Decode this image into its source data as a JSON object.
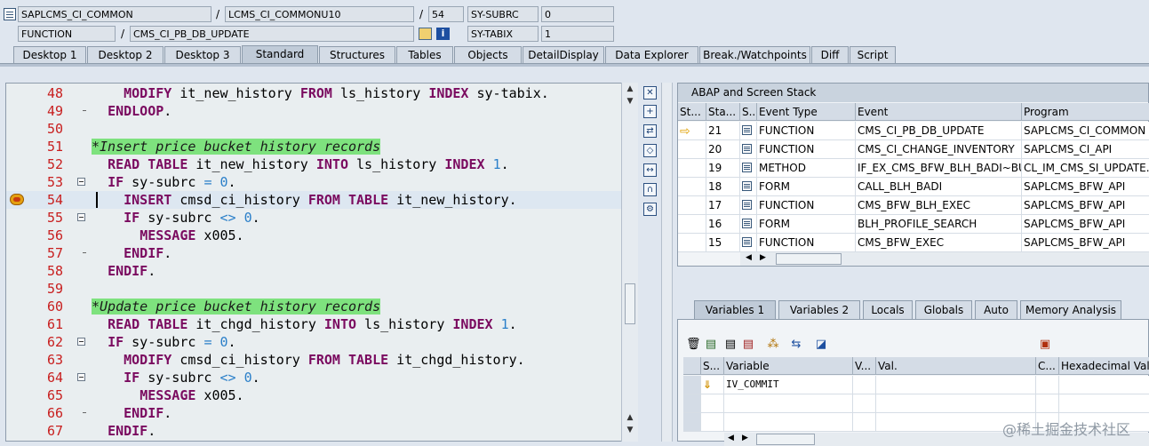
{
  "header": {
    "row1": {
      "program": "SAPLCMS_CI_COMMON",
      "include": "LCMS_CI_COMMONU10",
      "line": "54",
      "field_name": "SY-SUBRC",
      "field_value": "0"
    },
    "row2": {
      "type": "FUNCTION",
      "name": "CMS_CI_PB_DB_UPDATE",
      "field_name": "SY-TABIX",
      "field_value": "1"
    },
    "separator": "/",
    "info_glyph": "i"
  },
  "tabs": [
    "Desktop 1",
    "Desktop 2",
    "Desktop 3",
    "Standard",
    "Structures",
    "Tables",
    "Objects",
    "DetailDisplay",
    "Data Explorer",
    "Break./Watchpoints",
    "Diff",
    "Script"
  ],
  "active_tab": "Standard",
  "editor": {
    "lines": [
      {
        "n": "48",
        "tokens": [
          [
            "    ",
            ""
          ],
          [
            "MODIFY",
            "kw"
          ],
          [
            " it_new_history ",
            ""
          ],
          [
            "FROM",
            "kw"
          ],
          [
            " ls_history ",
            ""
          ],
          [
            "INDEX",
            "kw"
          ],
          [
            " sy-tabix.",
            ""
          ]
        ]
      },
      {
        "n": "49",
        "tokens": [
          [
            "  ",
            ""
          ],
          [
            "ENDLOOP",
            "kw"
          ],
          [
            ".",
            ""
          ]
        ]
      },
      {
        "n": "50",
        "tokens": []
      },
      {
        "n": "51",
        "tokens": [
          [
            "*Insert price bucket history records",
            "cmt"
          ]
        ]
      },
      {
        "n": "52",
        "tokens": [
          [
            "  ",
            ""
          ],
          [
            "READ TABLE",
            "kw"
          ],
          [
            " it_new_history ",
            ""
          ],
          [
            "INTO",
            "kw"
          ],
          [
            " ls_history ",
            ""
          ],
          [
            "INDEX",
            "kw"
          ],
          [
            " ",
            ""
          ],
          [
            "1",
            "num"
          ],
          [
            ".",
            ""
          ]
        ]
      },
      {
        "n": "53",
        "tokens": [
          [
            "  ",
            ""
          ],
          [
            "IF",
            "kw"
          ],
          [
            " sy-subrc ",
            ""
          ],
          [
            "=",
            "num"
          ],
          [
            " ",
            ""
          ],
          [
            "0",
            "num"
          ],
          [
            ".",
            ""
          ]
        ]
      },
      {
        "n": "54",
        "tokens": [
          [
            "    ",
            ""
          ],
          [
            "INSERT",
            "kw"
          ],
          [
            " cmsd_ci_history ",
            ""
          ],
          [
            "FROM TABLE",
            "kw"
          ],
          [
            " it_new_history.",
            ""
          ]
        ]
      },
      {
        "n": "55",
        "tokens": [
          [
            "    ",
            ""
          ],
          [
            "IF",
            "kw"
          ],
          [
            " sy-subrc ",
            ""
          ],
          [
            "<>",
            "num"
          ],
          [
            " ",
            ""
          ],
          [
            "0",
            "num"
          ],
          [
            ".",
            ""
          ]
        ]
      },
      {
        "n": "56",
        "tokens": [
          [
            "      ",
            ""
          ],
          [
            "MESSAGE",
            "kw"
          ],
          [
            " x005.",
            ""
          ]
        ]
      },
      {
        "n": "57",
        "tokens": [
          [
            "    ",
            ""
          ],
          [
            "ENDIF",
            "kw"
          ],
          [
            ".",
            ""
          ]
        ]
      },
      {
        "n": "58",
        "tokens": [
          [
            "  ",
            ""
          ],
          [
            "ENDIF",
            "kw"
          ],
          [
            ".",
            ""
          ]
        ]
      },
      {
        "n": "59",
        "tokens": []
      },
      {
        "n": "60",
        "tokens": [
          [
            "*Update price bucket history records",
            "cmt"
          ]
        ]
      },
      {
        "n": "61",
        "tokens": [
          [
            "  ",
            ""
          ],
          [
            "READ TABLE",
            "kw"
          ],
          [
            " it_chgd_history ",
            ""
          ],
          [
            "INTO",
            "kw"
          ],
          [
            " ls_history ",
            ""
          ],
          [
            "INDEX",
            "kw"
          ],
          [
            " ",
            ""
          ],
          [
            "1",
            "num"
          ],
          [
            ".",
            ""
          ]
        ]
      },
      {
        "n": "62",
        "tokens": [
          [
            "  ",
            ""
          ],
          [
            "IF",
            "kw"
          ],
          [
            " sy-subrc ",
            ""
          ],
          [
            "=",
            "num"
          ],
          [
            " ",
            ""
          ],
          [
            "0",
            "num"
          ],
          [
            ".",
            ""
          ]
        ]
      },
      {
        "n": "63",
        "tokens": [
          [
            "    ",
            ""
          ],
          [
            "MODIFY",
            "kw"
          ],
          [
            " cmsd_ci_history ",
            ""
          ],
          [
            "FROM TABLE",
            "kw"
          ],
          [
            " it_chgd_history.",
            ""
          ]
        ]
      },
      {
        "n": "64",
        "tokens": [
          [
            "    ",
            ""
          ],
          [
            "IF",
            "kw"
          ],
          [
            " sy-subrc ",
            ""
          ],
          [
            "<>",
            "num"
          ],
          [
            " ",
            ""
          ],
          [
            "0",
            "num"
          ],
          [
            ".",
            ""
          ]
        ]
      },
      {
        "n": "65",
        "tokens": [
          [
            "      ",
            ""
          ],
          [
            "MESSAGE",
            "kw"
          ],
          [
            " x005.",
            ""
          ]
        ]
      },
      {
        "n": "66",
        "tokens": [
          [
            "    ",
            ""
          ],
          [
            "ENDIF",
            "kw"
          ],
          [
            ".",
            ""
          ]
        ]
      },
      {
        "n": "67",
        "tokens": [
          [
            "  ",
            ""
          ],
          [
            "ENDIF",
            "kw"
          ],
          [
            ".",
            ""
          ]
        ]
      }
    ],
    "current_line": "54",
    "breakpoint_line": "54",
    "fold_lines": [
      "53",
      "55",
      "62",
      "64"
    ],
    "dash_lines": [
      "49",
      "57",
      "66"
    ]
  },
  "stack": {
    "title": "ABAP and Screen Stack",
    "headers": [
      "St...",
      "Sta...",
      "S...",
      "Event Type",
      "Event",
      "Program"
    ],
    "rows": [
      {
        "current": true,
        "level": "21",
        "type": "FUNCTION",
        "event": "CMS_CI_PB_DB_UPDATE",
        "program": "SAPLCMS_CI_COMMON"
      },
      {
        "current": false,
        "level": "20",
        "type": "FUNCTION",
        "event": "CMS_CI_CHANGE_INVENTORY",
        "program": "SAPLCMS_CI_API"
      },
      {
        "current": false,
        "level": "19",
        "type": "METHOD",
        "event": "IF_EX_CMS_BFW_BLH_BADI~BU...",
        "program": "CL_IM_CMS_SI_UPDATE..."
      },
      {
        "current": false,
        "level": "18",
        "type": "FORM",
        "event": "CALL_BLH_BADI",
        "program": "SAPLCMS_BFW_API"
      },
      {
        "current": false,
        "level": "17",
        "type": "FUNCTION",
        "event": "CMS_BFW_BLH_EXEC",
        "program": "SAPLCMS_BFW_API"
      },
      {
        "current": false,
        "level": "16",
        "type": "FORM",
        "event": "BLH_PROFILE_SEARCH",
        "program": "SAPLCMS_BFW_API"
      },
      {
        "current": false,
        "level": "15",
        "type": "FUNCTION",
        "event": "CMS_BFW_EXEC",
        "program": "SAPLCMS_BFW_API"
      }
    ]
  },
  "variables": {
    "tabs": [
      "Variables 1",
      "Variables 2",
      "Locals",
      "Globals",
      "Auto",
      "Memory Analysis"
    ],
    "active_tab": "Variables 1",
    "headers": [
      "S...",
      "Variable",
      "V...",
      "Val.",
      "C...",
      "Hexadecimal Value"
    ],
    "rows": [
      {
        "variable": "IV_COMMIT",
        "value": ""
      },
      {
        "variable": "",
        "value": ""
      },
      {
        "variable": "",
        "value": ""
      }
    ]
  },
  "watermark": "@稀土掘金技术社区",
  "colors": {
    "keyword": "#7a0a5f",
    "number": "#2a7fc9",
    "comment_bg": "#7ee27e",
    "line_number": "#c81e1e"
  }
}
